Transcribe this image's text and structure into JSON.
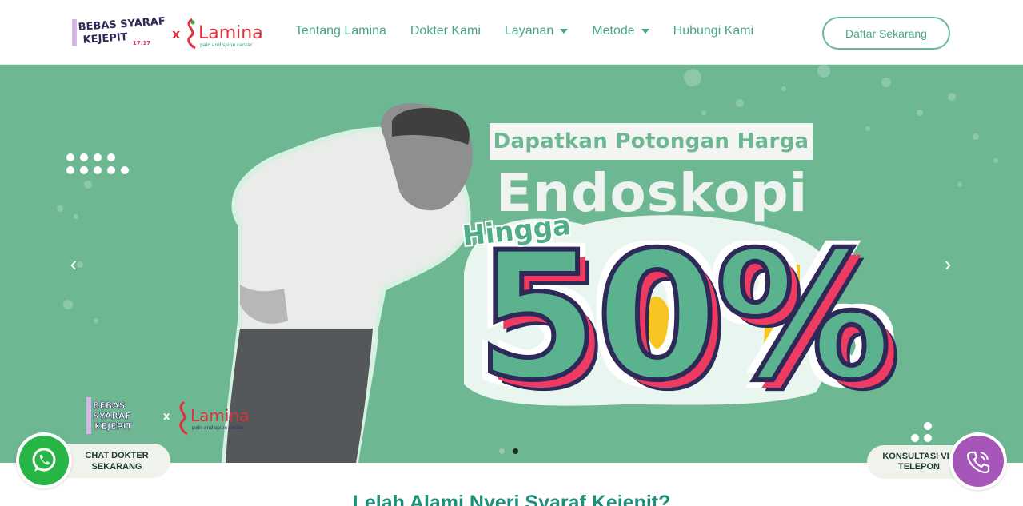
{
  "header": {
    "logo_left_text": "BEBAS SYARAF KEJEPIT 17.17",
    "logo_x": "x",
    "logo_brand": "Lamina",
    "logo_tagline": "pain and spine center",
    "nav": [
      {
        "label": "Tentang Lamina",
        "has_dropdown": false
      },
      {
        "label": "Dokter Kami",
        "has_dropdown": false
      },
      {
        "label": "Layanan",
        "has_dropdown": true
      },
      {
        "label": "Metode",
        "has_dropdown": true
      },
      {
        "label": "Hubungi Kami",
        "has_dropdown": false
      }
    ],
    "cta_label": "Daftar Sekarang"
  },
  "hero": {
    "promo_line1": "Dapatkan Potongan Harga",
    "promo_title": "Endoskopi",
    "promo_hingga": "Hingga",
    "promo_value": "50%",
    "prev_icon": "‹",
    "next_icon": "›",
    "slide_count": 2,
    "active_slide": 2,
    "logo_left_text": "BEBAS SYARAF KEJEPIT 17.17",
    "logo_x": "x",
    "logo_brand": "Lamina",
    "logo_tagline": "pain and spine center"
  },
  "widgets": {
    "whatsapp_label": "CHAT DOKTER SEKARANG",
    "whatsapp_icon": "whatsapp-icon",
    "call_label": "KONSULTASI VIA TELEPON",
    "call_icon": "phone-icon"
  },
  "section": {
    "heading": "Lelah Alami Nyeri Syaraf Kejepit?"
  },
  "colors": {
    "brand_green": "#4aa486",
    "hero_bg": "#6db892",
    "accent_pink": "#ef3b62",
    "accent_navy": "#2d2a5a",
    "accent_yellow": "#f7c623",
    "whatsapp_green": "#27b546",
    "call_purple": "#a556b8"
  }
}
